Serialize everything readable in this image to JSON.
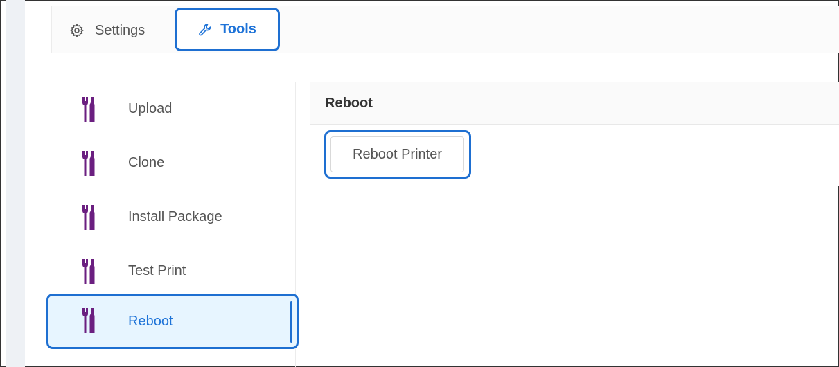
{
  "tabs": {
    "settings": {
      "label": "Settings",
      "icon": "gear-icon"
    },
    "tools": {
      "label": "Tools",
      "icon": "wrench-icon",
      "active": true
    }
  },
  "sidebar": {
    "items": [
      {
        "label": "Upload",
        "icon": "tools-icon"
      },
      {
        "label": "Clone",
        "icon": "tools-icon"
      },
      {
        "label": "Install Package",
        "icon": "tools-icon"
      },
      {
        "label": "Test Print",
        "icon": "tools-icon"
      },
      {
        "label": "Reboot",
        "icon": "tools-icon",
        "active": true
      }
    ]
  },
  "panel": {
    "title": "Reboot",
    "button_label": "Reboot Printer"
  },
  "colors": {
    "accent": "#1e73d8",
    "highlight_border": "#1e6fd1",
    "active_bg": "#e7f5ff",
    "tool_icon": "#6b1f80"
  }
}
